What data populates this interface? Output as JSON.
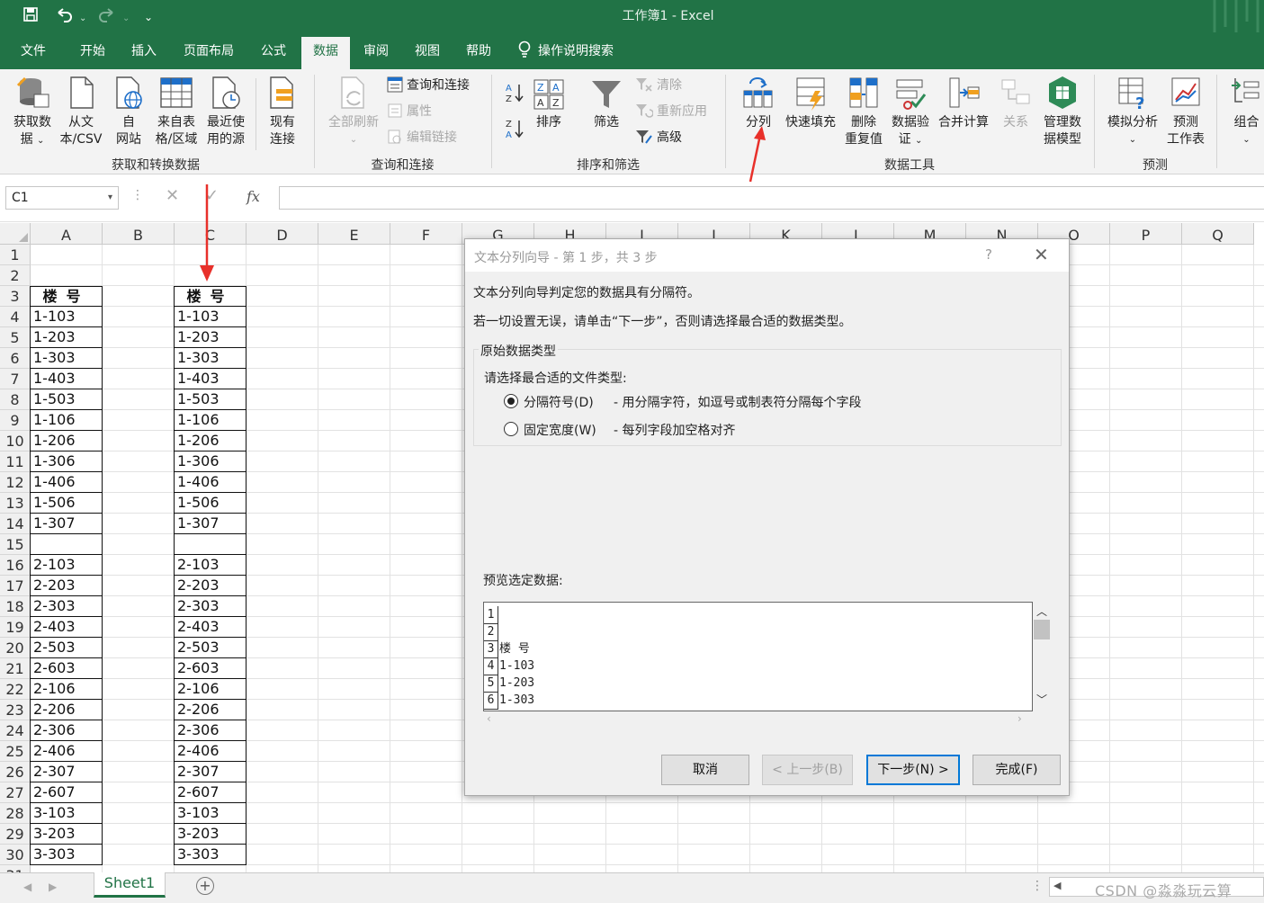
{
  "app": {
    "title": "工作簿1  -  Excel"
  },
  "tabs": [
    "文件",
    "开始",
    "插入",
    "页面布局",
    "公式",
    "数据",
    "审阅",
    "视图",
    "帮助"
  ],
  "tell_me": "操作说明搜索",
  "ribbon": {
    "get_data": [
      "获取数",
      "据"
    ],
    "from_csv": [
      "从文",
      "本/CSV"
    ],
    "from_web": [
      "自",
      "网站"
    ],
    "from_table": [
      "来自表",
      "格/区域"
    ],
    "recent": [
      "最近使",
      "用的源"
    ],
    "existing": [
      "现有",
      "连接"
    ],
    "group1": "获取和转换数据",
    "refresh_all": "全部刷新",
    "queries_conn": "查询和连接",
    "properties": "属性",
    "edit_links": "编辑链接",
    "group2": "查询和连接",
    "sort": "排序",
    "filter": "筛选",
    "clear": "清除",
    "reapply": "重新应用",
    "advanced": "高级",
    "group3": "排序和筛选",
    "text_to_columns": "分列",
    "flash_fill": "快速填充",
    "remove_dup": [
      "删除",
      "重复值"
    ],
    "data_validation": [
      "数据验",
      "证"
    ],
    "consolidate": "合并计算",
    "relations": "关系",
    "data_model": [
      "管理数",
      "据模型"
    ],
    "group4": "数据工具",
    "what_if": "模拟分析",
    "forecast": [
      "预测",
      "工作表"
    ],
    "group5": "预测",
    "outline": "组合"
  },
  "formula_bar": {
    "name_box": "C1",
    "fx": "fx"
  },
  "columns": [
    "A",
    "B",
    "C",
    "D",
    "E",
    "F",
    "G",
    "H",
    "I",
    "J",
    "K",
    "L",
    "M",
    "N",
    "O",
    "P",
    "Q"
  ],
  "sheet": {
    "header": "楼号",
    "col_a": [
      "1-103",
      "1-203",
      "1-303",
      "1-403",
      "1-503",
      "1-106",
      "1-206",
      "1-306",
      "1-406",
      "1-506",
      "1-307",
      "",
      "2-103",
      "2-203",
      "2-303",
      "2-403",
      "2-503",
      "2-603",
      "2-106",
      "2-206",
      "2-306",
      "2-406",
      "2-307",
      "2-607",
      "3-103",
      "3-203",
      "3-303"
    ],
    "col_c": [
      "1-103",
      "1-203",
      "1-303",
      "1-403",
      "1-503",
      "1-106",
      "1-206",
      "1-306",
      "1-406",
      "1-506",
      "1-307",
      "",
      "2-103",
      "2-203",
      "2-303",
      "2-403",
      "2-503",
      "2-603",
      "2-106",
      "2-206",
      "2-306",
      "2-406",
      "2-307",
      "2-607",
      "3-103",
      "3-203",
      "3-303"
    ]
  },
  "sheet_tab": "Sheet1",
  "watermark": "CSDN @淼淼玩云算",
  "dialog": {
    "title": "文本分列向导 - 第 1 步，共 3 步",
    "help": "?",
    "line1": "文本分列向导判定您的数据具有分隔符。",
    "line2": "若一切设置无误，请单击“下一步”，否则请选择最合适的数据类型。",
    "group_title": "原始数据类型",
    "choose": "请选择最合适的文件类型:",
    "opt1_label": "分隔符号(D)",
    "opt1_desc": "- 用分隔字符，如逗号或制表符分隔每个字段",
    "opt2_label": "固定宽度(W)",
    "opt2_desc": "- 每列字段加空格对齐",
    "preview_label": "预览选定数据:",
    "preview_lines": [
      "",
      "",
      "楼     号",
      "1-103",
      "1-203",
      "1-303"
    ],
    "btn_cancel": "取消",
    "btn_back": "< 上一步(B)",
    "btn_next": "下一步(N) >",
    "btn_finish": "完成(F)"
  },
  "colors": {
    "excel_green": "#217346",
    "annotation_red": "#e8302a",
    "accent": "#0078d7"
  }
}
